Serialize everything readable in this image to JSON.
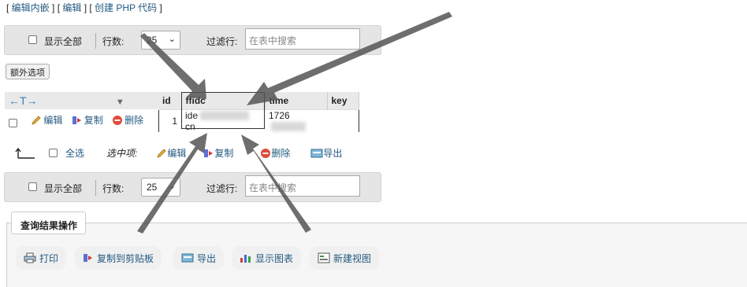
{
  "top_links": {
    "edit_inline": "编辑内嵌",
    "edit": "编辑",
    "create_php": "创建 PHP 代码"
  },
  "nav_top": {
    "show_all": "显示全部",
    "rows_label": "行数:",
    "rows_value": "25",
    "filter_label": "过滤行:",
    "filter_placeholder": "在表中搜索"
  },
  "extra_options": "额外选项",
  "table": {
    "columns": [
      "id",
      "ffidc",
      "time",
      "key"
    ],
    "row": {
      "actions": {
        "edit": "编辑",
        "copy": "复制",
        "delete": "删除"
      },
      "id": "1",
      "ffidc_prefix": "ide",
      "ffidc_suffix": "cn",
      "time_prefix": "1726"
    }
  },
  "bulk": {
    "select_all": "全选",
    "selected_label": "选中项:",
    "edit": "编辑",
    "copy": "复制",
    "delete": "删除",
    "export": "导出"
  },
  "nav_bottom": {
    "show_all": "显示全部",
    "rows_label": "行数:",
    "rows_value": "25",
    "filter_label": "过滤行:",
    "filter_placeholder": "在表中搜索"
  },
  "query_ops": {
    "title": "查询结果操作",
    "print": "打印",
    "copy_clipboard": "复制到剪贴板",
    "export": "导出",
    "show_chart": "显示图表",
    "create_view": "新建视图"
  },
  "colors": {
    "link": "#235a81",
    "bar_bg": "#e5e5e5",
    "overlay_arrow": "#555555"
  }
}
